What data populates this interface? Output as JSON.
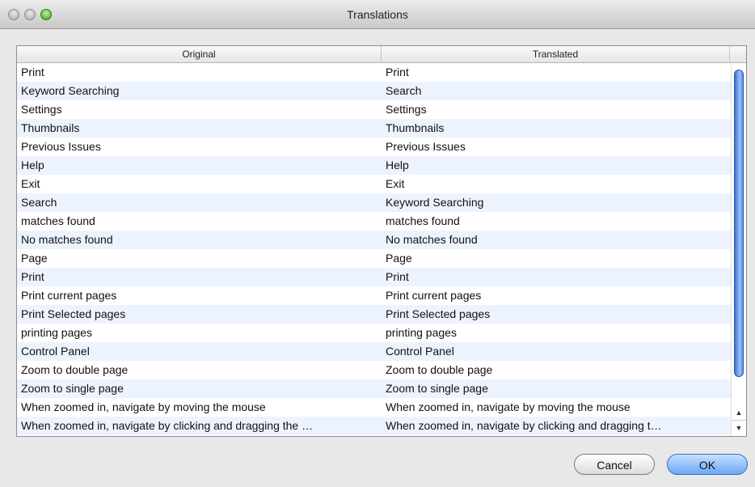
{
  "window": {
    "title": "Translations"
  },
  "table": {
    "columns": [
      "Original",
      "Translated"
    ],
    "rows": [
      [
        "Print",
        "Print"
      ],
      [
        "Keyword Searching",
        "Search"
      ],
      [
        "Settings",
        "Settings"
      ],
      [
        "Thumbnails",
        "Thumbnails"
      ],
      [
        "Previous Issues",
        "Previous Issues"
      ],
      [
        "Help",
        "Help"
      ],
      [
        "Exit",
        "Exit"
      ],
      [
        "Search",
        "Keyword Searching"
      ],
      [
        "matches found",
        "matches found"
      ],
      [
        "No matches found",
        "No matches found"
      ],
      [
        "Page",
        "Page"
      ],
      [
        "Print",
        "Print"
      ],
      [
        "Print current pages",
        "Print current pages"
      ],
      [
        "Print Selected pages",
        "Print Selected pages"
      ],
      [
        "printing pages",
        "printing pages"
      ],
      [
        "Control Panel",
        "Control Panel"
      ],
      [
        "Zoom to double page",
        "Zoom to double page"
      ],
      [
        "Zoom to single page",
        "Zoom to single page"
      ],
      [
        "When zoomed in, navigate by moving the mouse",
        "When zoomed in, navigate by moving the mouse"
      ],
      [
        "When zoomed in, navigate by clicking and dragging the …",
        "When zoomed in, navigate by clicking and dragging t…"
      ]
    ]
  },
  "buttons": {
    "cancel": "Cancel",
    "ok": "OK"
  },
  "icons": {
    "close": "close-icon",
    "minimize": "minimize-icon",
    "zoom": "zoom-icon",
    "scroll_up": "scroll-up-icon",
    "scroll_down": "scroll-down-icon"
  }
}
